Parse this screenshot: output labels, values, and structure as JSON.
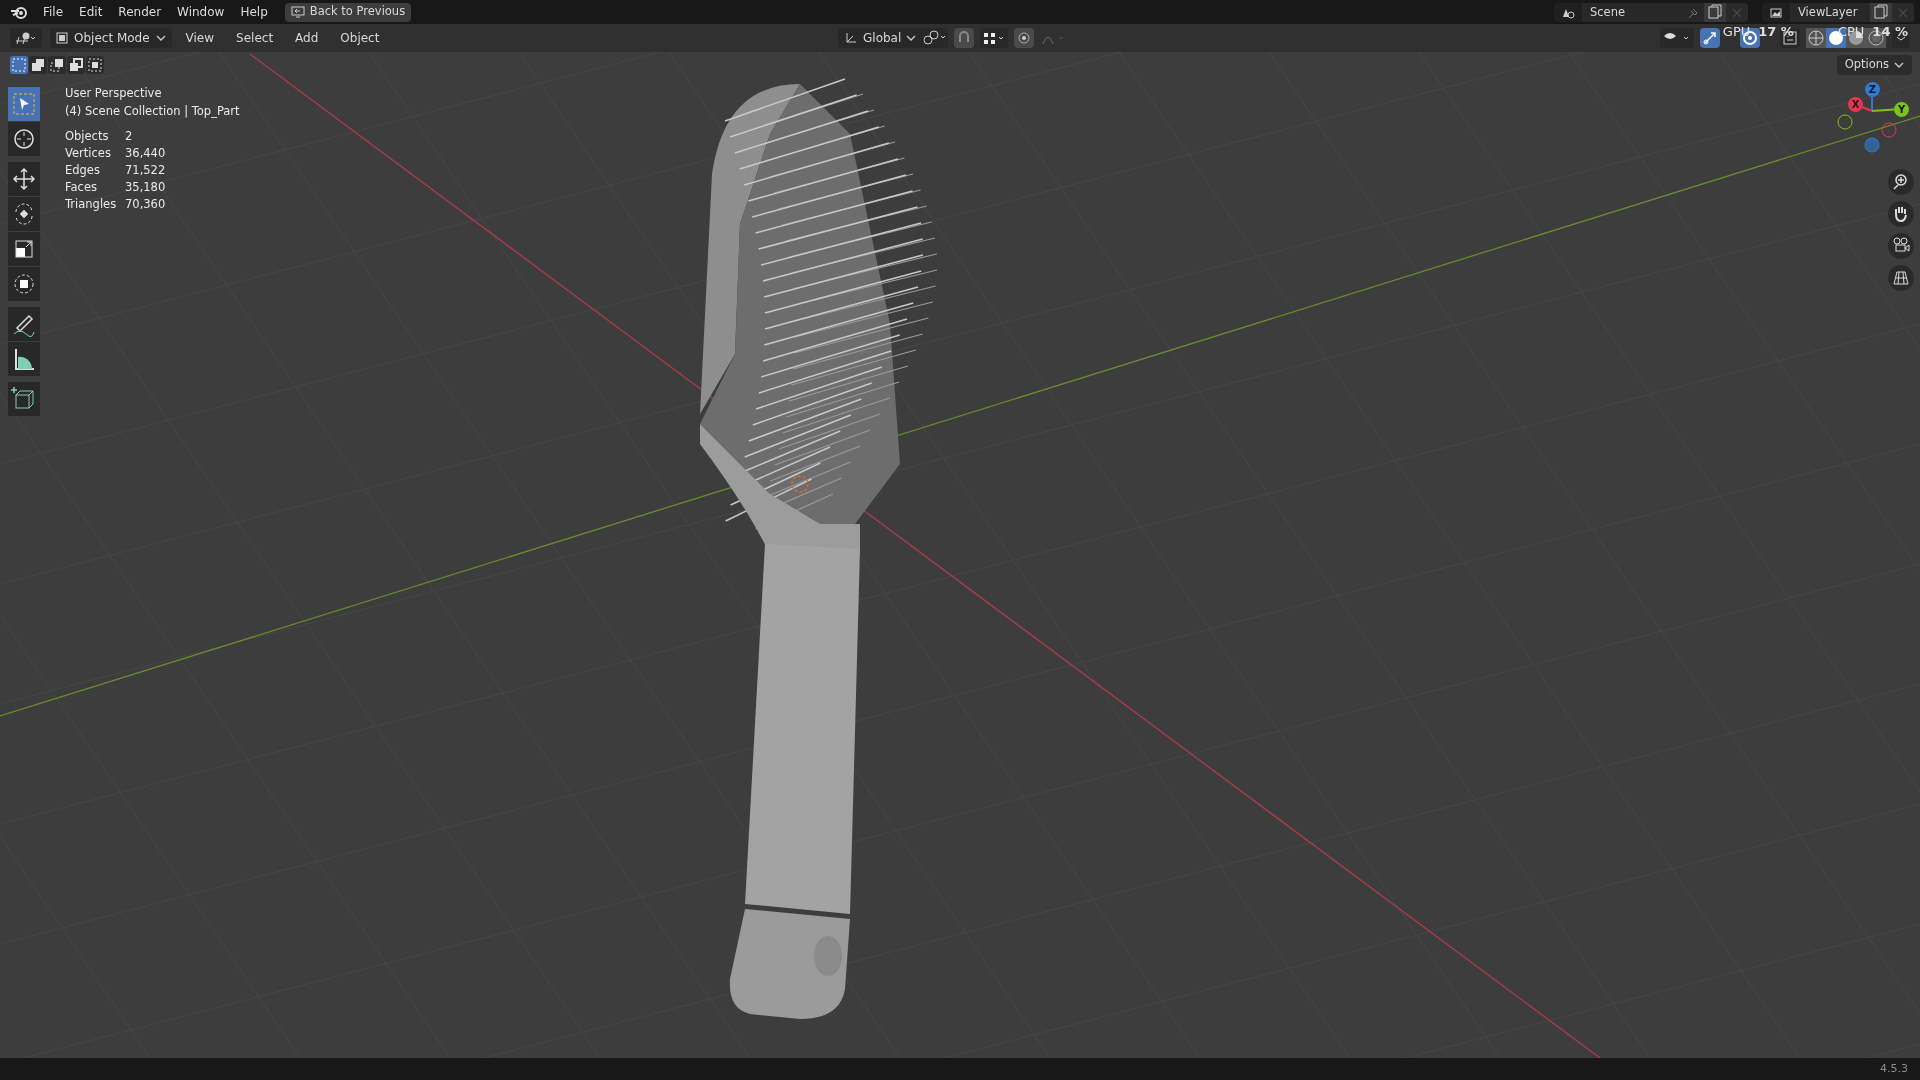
{
  "topbar": {
    "menus": [
      "File",
      "Edit",
      "Render",
      "Window",
      "Help"
    ],
    "back_button": "Back to Previous",
    "scene": "Scene",
    "view_layer": "ViewLayer"
  },
  "header": {
    "mode": "Object Mode",
    "menus": [
      "View",
      "Select",
      "Add",
      "Object"
    ],
    "orientation": "Global",
    "select_modes": [
      {
        "kind": "set",
        "selected": true
      },
      {
        "kind": "extend",
        "selected": false
      },
      {
        "kind": "subtract",
        "selected": false
      },
      {
        "kind": "invert",
        "selected": false
      },
      {
        "kind": "intersect",
        "selected": false
      }
    ],
    "gizmo_on": true,
    "overlays_on": true,
    "shading": [
      {
        "kind": "wireframe",
        "selected": false
      },
      {
        "kind": "solid",
        "selected": true
      },
      {
        "kind": "material",
        "selected": false
      },
      {
        "kind": "rendered",
        "selected": false
      }
    ]
  },
  "performance": [
    {
      "label": "GPU",
      "value": "17 %"
    },
    {
      "label": "CPU",
      "value": "14 %"
    }
  ],
  "options": "Options",
  "viewport": {
    "view_name": "User Perspective",
    "collection": "(4) Scene Collection | Top_Part",
    "stats": [
      {
        "label": "Objects",
        "value": "2"
      },
      {
        "label": "Vertices",
        "value": "36,440"
      },
      {
        "label": "Edges",
        "value": "71,522"
      },
      {
        "label": "Faces",
        "value": "35,180"
      },
      {
        "label": "Triangles",
        "value": "70,360"
      }
    ]
  },
  "toolbar": [
    {
      "kind": "select",
      "selected": true
    },
    {
      "kind": "cursor",
      "selected": false
    },
    {
      "kind": "move",
      "selected": false
    },
    {
      "kind": "rotate",
      "selected": false
    },
    {
      "kind": "scale",
      "selected": false
    },
    {
      "kind": "transform",
      "selected": false
    },
    {
      "kind": "annotate",
      "selected": false
    },
    {
      "kind": "measure",
      "selected": false
    },
    {
      "kind": "add_cube",
      "selected": false
    }
  ],
  "gizmo_axes": [
    {
      "label": "X",
      "color": "#e8354e"
    },
    {
      "label": "Y",
      "color": "#7dc21d"
    },
    {
      "label": "Z",
      "color": "#2f7ad6"
    }
  ],
  "version": "4.5.3"
}
